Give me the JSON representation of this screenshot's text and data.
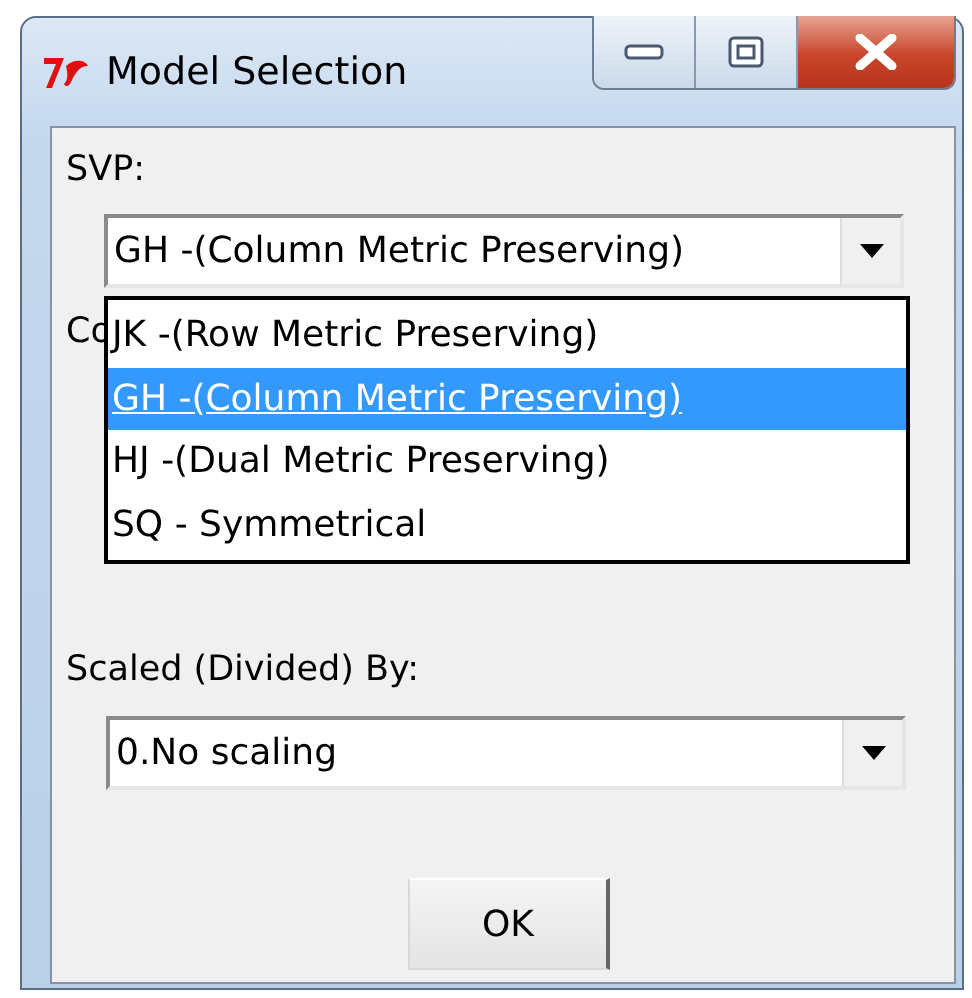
{
  "window": {
    "title": "Model Selection"
  },
  "svp": {
    "label": "SVP:",
    "value": "GH -(Column Metric Preserving)",
    "expanded": true,
    "options": [
      {
        "label": "JK -(Row Metric Preserving)",
        "selected": false
      },
      {
        "label": "GH -(Column Metric Preserving)",
        "selected": true
      },
      {
        "label": "HJ -(Dual Metric Preserving)",
        "selected": false
      },
      {
        "label": "SQ - Symmetrical",
        "selected": false
      }
    ]
  },
  "second_field": {
    "label": "Co"
  },
  "scaling": {
    "label": "Scaled (Divided) By:",
    "value": "0.No scaling"
  },
  "buttons": [
    {
      "label": "OK"
    }
  ]
}
